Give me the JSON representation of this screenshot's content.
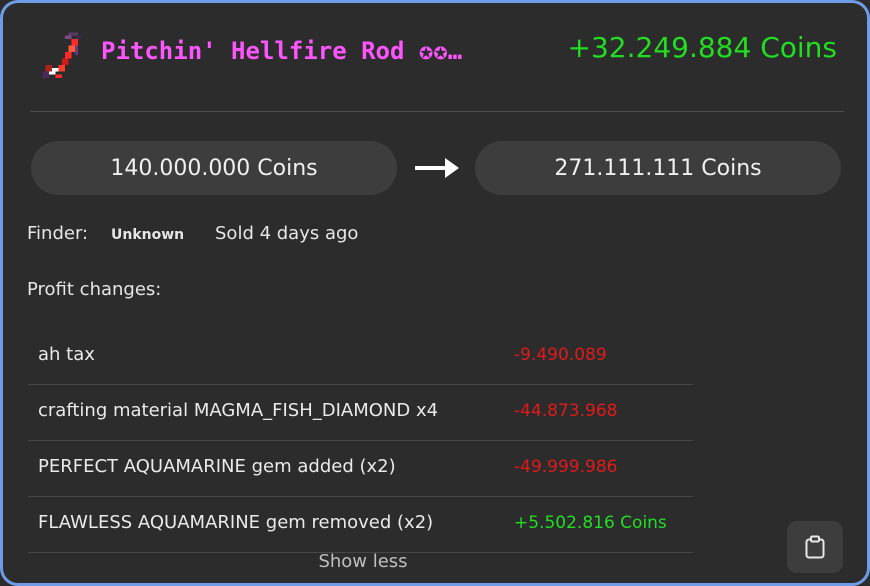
{
  "item": {
    "name": "Pitchin' Hellfire Rod ✪✪…",
    "icon": "fishing-rod-icon",
    "profit": "+32.249.884 Coins"
  },
  "prices": {
    "buy": "140.000.000 Coins",
    "sell": "271.111.111 Coins",
    "arrow_icon": "arrow-right-icon"
  },
  "meta": {
    "finder_label": "Finder:",
    "finder_value": "Unknown",
    "sold": "Sold 4 days ago"
  },
  "profit_changes": {
    "title": "Profit changes:",
    "rows": [
      {
        "label": "ah tax",
        "value": "-9.490.089",
        "sign": "negative"
      },
      {
        "label": "crafting material MAGMA_FISH_DIAMOND x4",
        "value": "-44.873.968",
        "sign": "negative"
      },
      {
        "label": "PERFECT AQUAMARINE gem added (x2)",
        "value": "-49.999.986",
        "sign": "negative"
      },
      {
        "label": "FLAWLESS AQUAMARINE gem removed (x2)",
        "value": "+5.502.816 Coins",
        "sign": "positive"
      }
    ]
  },
  "actions": {
    "show_less": "Show less",
    "copy_icon": "clipboard-icon"
  },
  "colors": {
    "border": "#6e9ce6",
    "item_name": "#ff55ff",
    "positive": "#22dd22",
    "negative": "#e01a1a"
  }
}
